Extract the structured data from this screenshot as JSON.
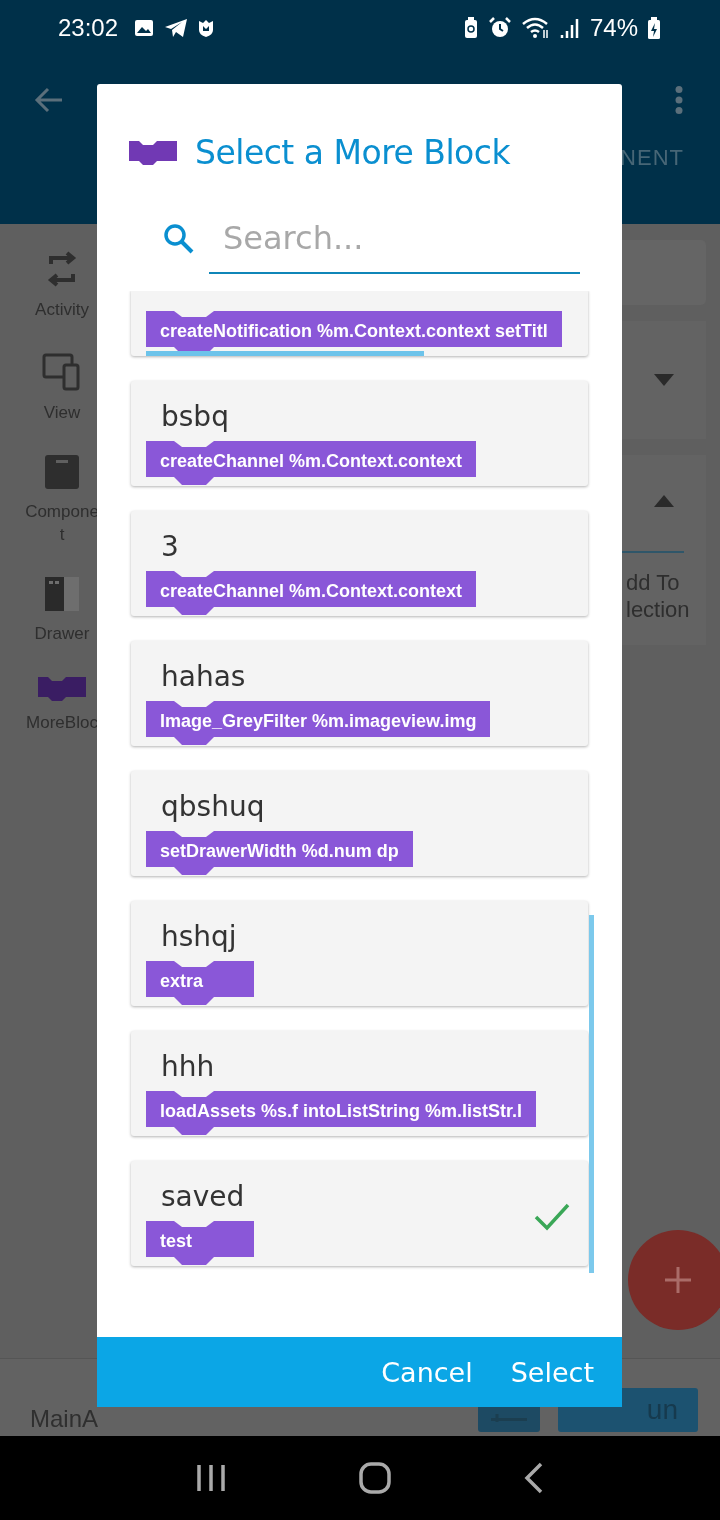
{
  "status_bar": {
    "time": "23:02",
    "battery": "74%"
  },
  "app_bar": {
    "tab_fragment": "NENT"
  },
  "sidebar": {
    "items": [
      {
        "kind": "activity",
        "lines": [
          "Activity"
        ]
      },
      {
        "kind": "view",
        "lines": [
          "View"
        ]
      },
      {
        "kind": "component",
        "lines": [
          "Compone",
          "t"
        ]
      },
      {
        "kind": "drawer",
        "lines": [
          "Drawer"
        ]
      },
      {
        "kind": "moreblock",
        "lines": [
          "MoreBloc"
        ]
      }
    ]
  },
  "side_panel": {
    "lines": [
      "dd To",
      "lection"
    ]
  },
  "bottom_bar": {
    "file": "MainA",
    "run": "un"
  },
  "dialog": {
    "title": "Select a More Block",
    "search": {
      "placeholder": "Search..."
    },
    "items": [
      {
        "block": "createNotification %m.Context.context setTitl",
        "selected": false
      },
      {
        "name": "bsbq",
        "block": "createChannel %m.Context.context",
        "selected": false
      },
      {
        "name": "3",
        "block": "createChannel %m.Context.context",
        "selected": false
      },
      {
        "name": "hahas",
        "block": "Image_GreyFilter %m.imageview.img",
        "selected": false
      },
      {
        "name": "qbshuq",
        "block": "setDrawerWidth %d.num dp",
        "selected": false
      },
      {
        "name": "hshqj",
        "block": "extra",
        "selected": false
      },
      {
        "name": "hhh",
        "block": "loadAssets %s.f intoListString %m.listStr.l",
        "selected": false
      },
      {
        "name": "saved",
        "block": "test",
        "selected": true
      }
    ],
    "buttons": {
      "cancel": "Cancel",
      "select": "Select"
    }
  }
}
